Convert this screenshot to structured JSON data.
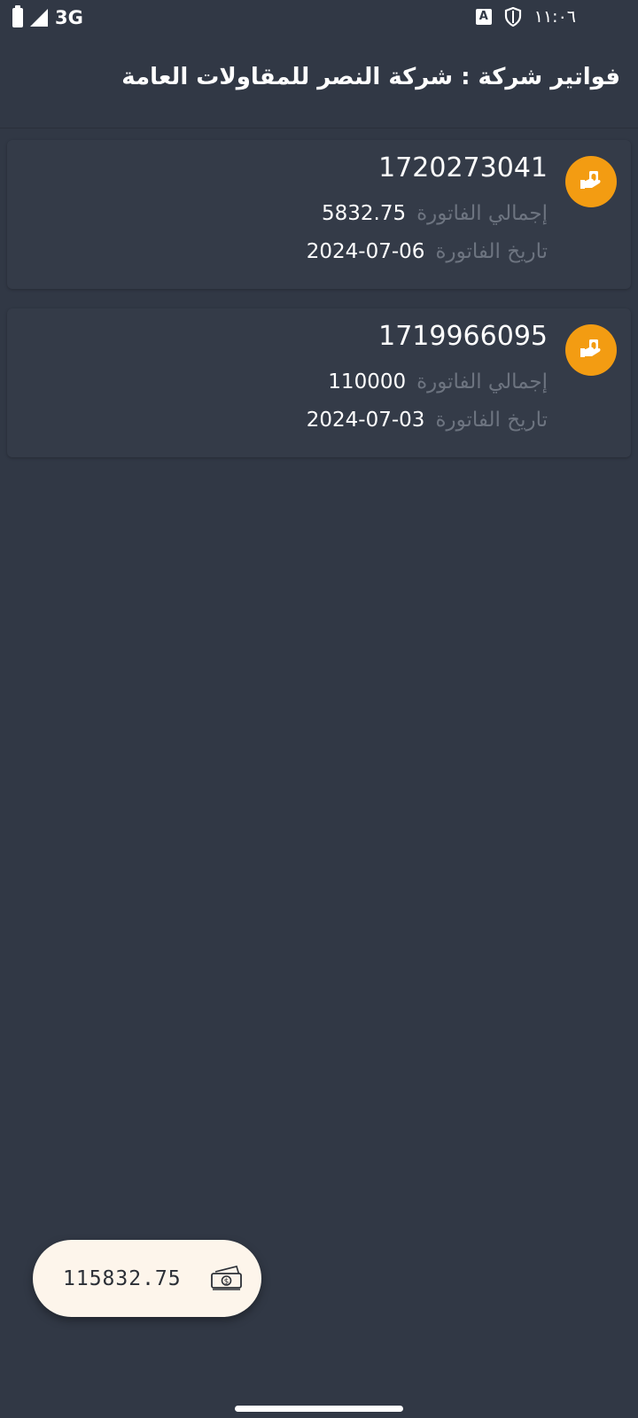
{
  "status_bar": {
    "network": "3G",
    "keyboard_indicator": "A",
    "time": "١١:٠٦"
  },
  "header": {
    "title": "فواتير شركة : شركة النصر للمقاولات العامة"
  },
  "labels": {
    "total": "إجمالي الفاتورة",
    "date": "تاريخ الفاتورة"
  },
  "invoices": [
    {
      "number": "1720273041",
      "total": "5832.75",
      "date": "2024-07-06"
    },
    {
      "number": "1719966095",
      "total": "110000",
      "date": "2024-07-03"
    }
  ],
  "summary": {
    "grand_total": "115832.75"
  },
  "colors": {
    "background": "#313845",
    "card": "#343b48",
    "accent": "#f39c12",
    "fab": "#fdf5eb"
  },
  "icons": {
    "invoice_avatar": "hand-money-icon",
    "summary": "money-bill-icon"
  }
}
